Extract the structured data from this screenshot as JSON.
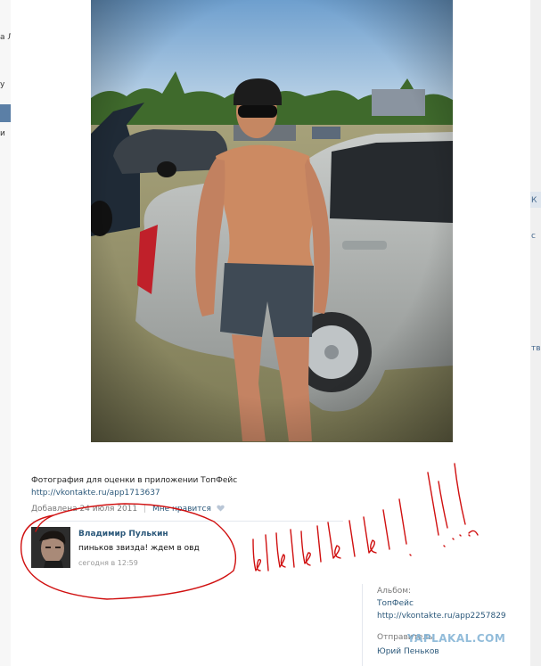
{
  "background_left": {
    "fragments": [
      "а Л",
      "у",
      "и"
    ]
  },
  "background_right": {
    "fragments": [
      "К",
      "с",
      "тв"
    ]
  },
  "viewer": {
    "description_text": "Фотография для оценки в приложении ТопФейс",
    "description_link": "http://vkontakte.ru/app1713637",
    "added_label": "Добавлена 24 июля 2011",
    "separator": "|",
    "like_label": "Мне нравится",
    "comment": {
      "author": "Владимир Пулькин",
      "text": "пиньков звизда! ждем в овд",
      "time": "сегодня в 12:59"
    },
    "album": {
      "label": "Альбом:",
      "link": "ТопФейс http://vkontakte.ru/app2257829"
    },
    "sender": {
      "label": "Отправитель:",
      "name": "Юрий Пеньков"
    }
  },
  "annotation": {
    "scribble_text": "ыыыыы!!!..."
  },
  "watermark": "YAPLAKAL.COM",
  "colors": {
    "link": "#2b587a",
    "scribble": "#d01010",
    "watermark": "#7fb1d4"
  }
}
